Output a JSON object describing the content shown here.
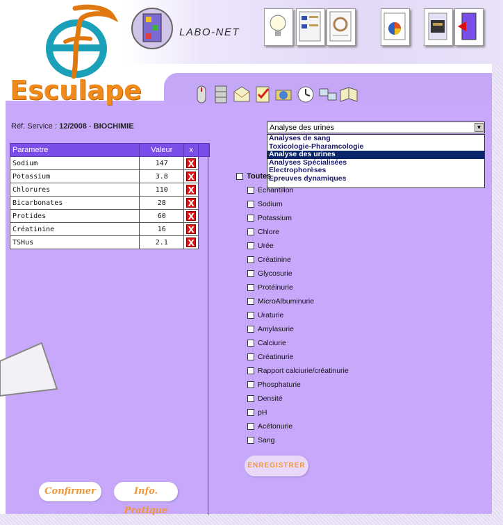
{
  "app": {
    "brand": "Esculape",
    "module": "Labo-Net"
  },
  "header": {
    "toolbar_top": [
      {
        "name": "lightbulb-icon"
      },
      {
        "name": "document-list-icon"
      },
      {
        "name": "spreadsheet-icon"
      },
      {
        "name": "pie-chart-icon"
      },
      {
        "name": "chip-icon"
      },
      {
        "name": "exit-door-icon"
      }
    ],
    "toolbar_bottom": [
      {
        "name": "mouse-icon"
      },
      {
        "name": "cabinet-icon"
      },
      {
        "name": "mail-icon"
      },
      {
        "name": "checklist-icon"
      },
      {
        "name": "folder-network-icon"
      },
      {
        "name": "clock-icon"
      },
      {
        "name": "computers-icon"
      },
      {
        "name": "help-book-icon"
      }
    ]
  },
  "service": {
    "label": "Réf. Service :",
    "value": "12/2008",
    "sep": " - ",
    "dept": "BIOCHIMIE"
  },
  "table": {
    "headers": [
      "Parametre",
      "Valeur",
      "x"
    ],
    "rows": [
      {
        "param": "Sodium",
        "value": "147"
      },
      {
        "param": "Potassium",
        "value": "3.8"
      },
      {
        "param": "Chlorures",
        "value": "110"
      },
      {
        "param": "Bicarbonates",
        "value": "28"
      },
      {
        "param": "Protides",
        "value": "60"
      },
      {
        "param": "Créatinine",
        "value": "16"
      },
      {
        "param": "TSHus",
        "value": "2.1"
      }
    ],
    "delete_glyph": "X"
  },
  "buttons": {
    "confirm": "Confirmer",
    "info": "Info. Pratique",
    "save": "ENREGISTRER"
  },
  "analysis_select": {
    "selected": "Analyse des urines",
    "options": [
      "Analyses de sang",
      "Toxicologie-Pharamcologie",
      "Analyse des urines",
      "Analyses Spécialisées",
      "Electrophorèses",
      "Epreuves dynamiques"
    ],
    "highlighted_index": 2
  },
  "checklist": {
    "all_label": "Toutes",
    "items": [
      "Echantillon",
      "Sodium",
      "Potassium",
      "Chlore",
      "Urée",
      "Créatinine",
      "Glycosurie",
      "Protéinurie",
      "MicroAlbuminurie",
      "Uraturie",
      "Amylasurie",
      "Calciurie",
      "Créatinurie",
      "Rapport calciurie/créatinurie",
      "Phosphaturie",
      "Densité",
      "pH",
      "Acétonurie",
      "Sang"
    ]
  },
  "colors": {
    "panel": "#c7a8fa",
    "table_header": "#7a4ee8",
    "brand_orange": "#f08a1c",
    "delete_red": "#e01010"
  }
}
